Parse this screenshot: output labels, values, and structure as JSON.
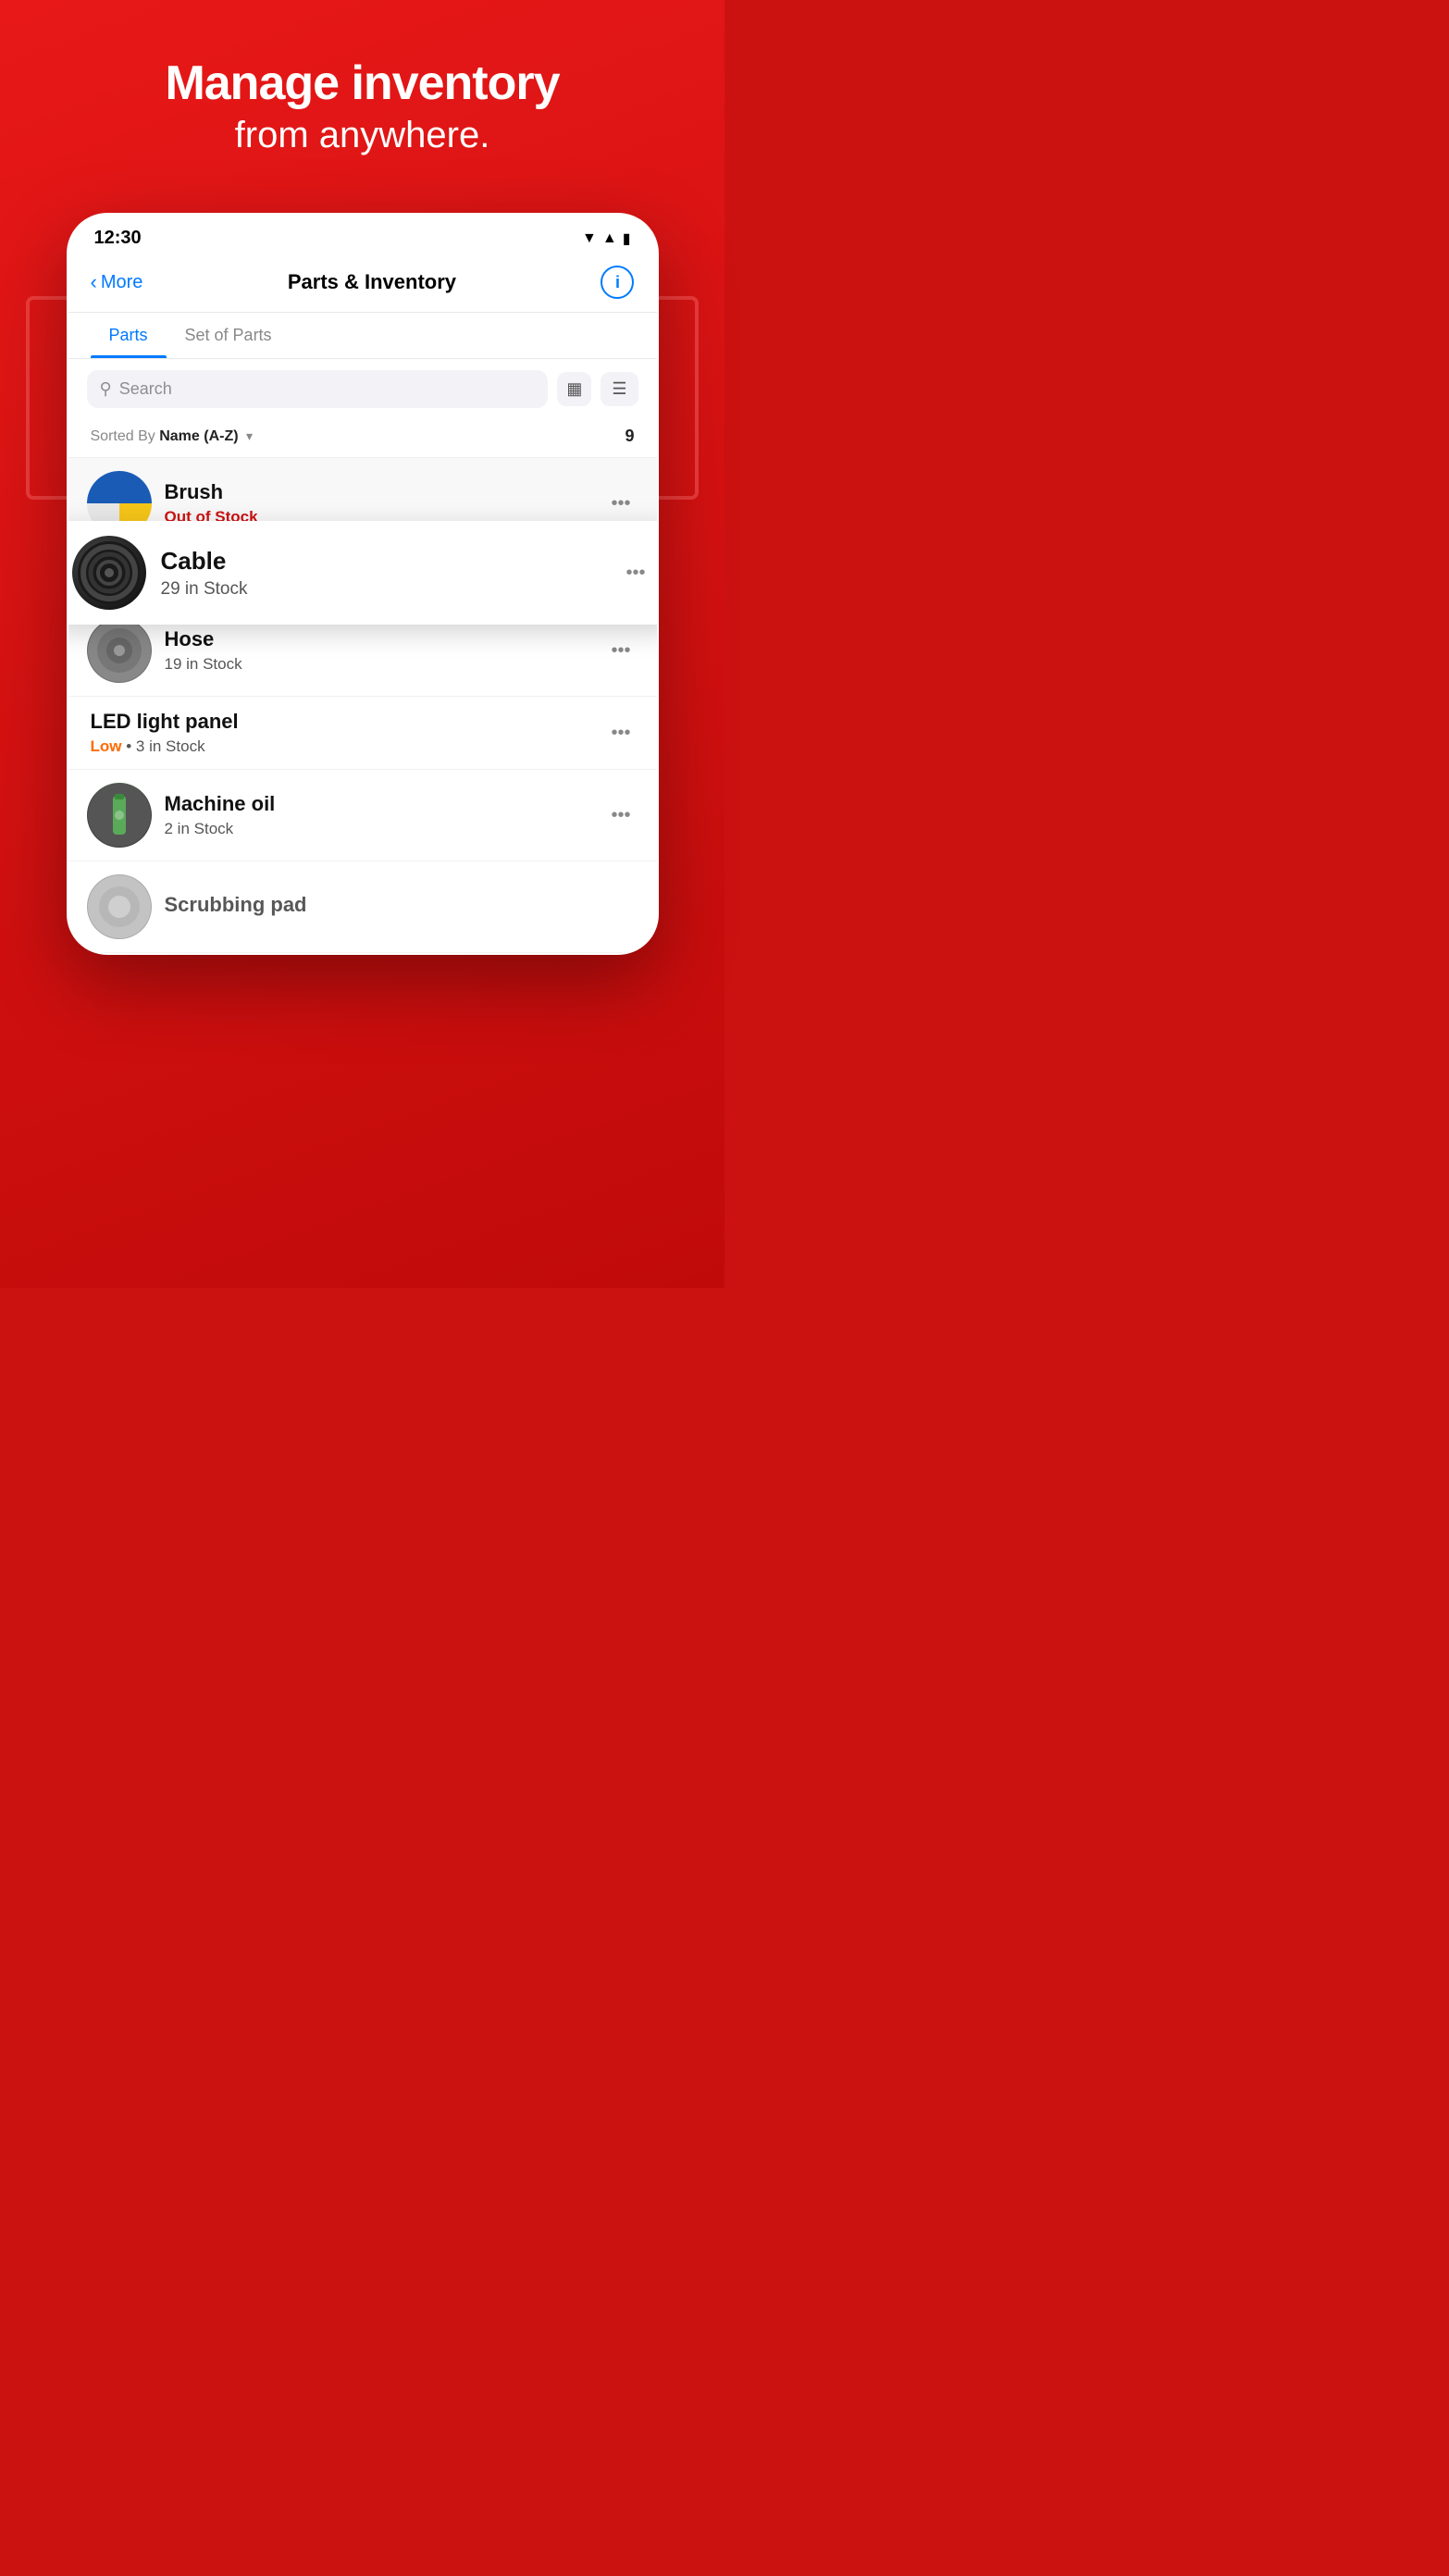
{
  "background": {
    "color": "#cc1111"
  },
  "hero": {
    "title": "Manage inventory",
    "subtitle": "from anywhere."
  },
  "phone": {
    "statusBar": {
      "time": "12:30",
      "wifiIcon": "▼",
      "signalIcon": "▲",
      "batteryIcon": "▮"
    },
    "navBar": {
      "backLabel": "More",
      "title": "Parts & Inventory",
      "infoIcon": "i"
    },
    "tabs": [
      {
        "label": "Parts",
        "active": true
      },
      {
        "label": "Set of Parts",
        "active": false
      }
    ],
    "search": {
      "placeholder": "Search",
      "barcodeIcon": "⊞",
      "filterIcon": "≡"
    },
    "sortRow": {
      "sortedByLabel": "Sorted By",
      "sortValue": "Name (A-Z)",
      "count": "9"
    },
    "items": [
      {
        "id": "brush",
        "name": "Brush",
        "stock": "Out of Stock",
        "stockType": "out",
        "hasImage": true
      },
      {
        "id": "cable",
        "name": "Cable",
        "stock": "29 in Stock",
        "stockType": "normal",
        "hasImage": true,
        "floating": true
      },
      {
        "id": "hose",
        "name": "Hose",
        "stock": "19 in Stock",
        "stockType": "normal",
        "hasImage": true
      },
      {
        "id": "led",
        "name": "LED light panel",
        "stock": "3 in Stock",
        "stockType": "low",
        "lowLabel": "Low",
        "hasImage": false
      },
      {
        "id": "machine-oil",
        "name": "Machine oil",
        "stock": "2 in Stock",
        "stockType": "normal",
        "hasImage": true
      },
      {
        "id": "scrubbing-pad",
        "name": "Scrubbing pad",
        "stock": "",
        "stockType": "normal",
        "hasImage": true
      }
    ]
  }
}
